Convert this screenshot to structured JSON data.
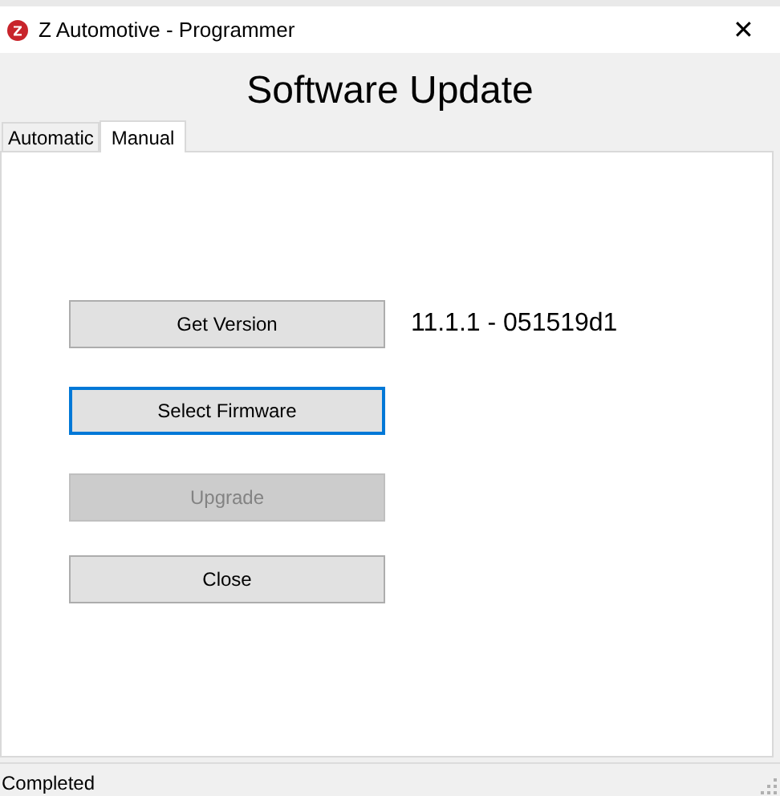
{
  "window": {
    "title": "Z Automotive - Programmer",
    "close": "✕"
  },
  "heading": "Software Update",
  "tabs": [
    {
      "label": "Automatic",
      "selected": false
    },
    {
      "label": "Manual",
      "selected": true
    }
  ],
  "buttons": [
    {
      "label": "Get Version",
      "focused": false,
      "disabled": false
    },
    {
      "label": "Select Firmware",
      "focused": true,
      "disabled": false
    },
    {
      "label": "Upgrade",
      "focused": false,
      "disabled": true
    },
    {
      "label": "Close",
      "focused": false,
      "disabled": false
    }
  ],
  "version_label": "11.1.1 - 051519d1",
  "status_bar": "Completed"
}
